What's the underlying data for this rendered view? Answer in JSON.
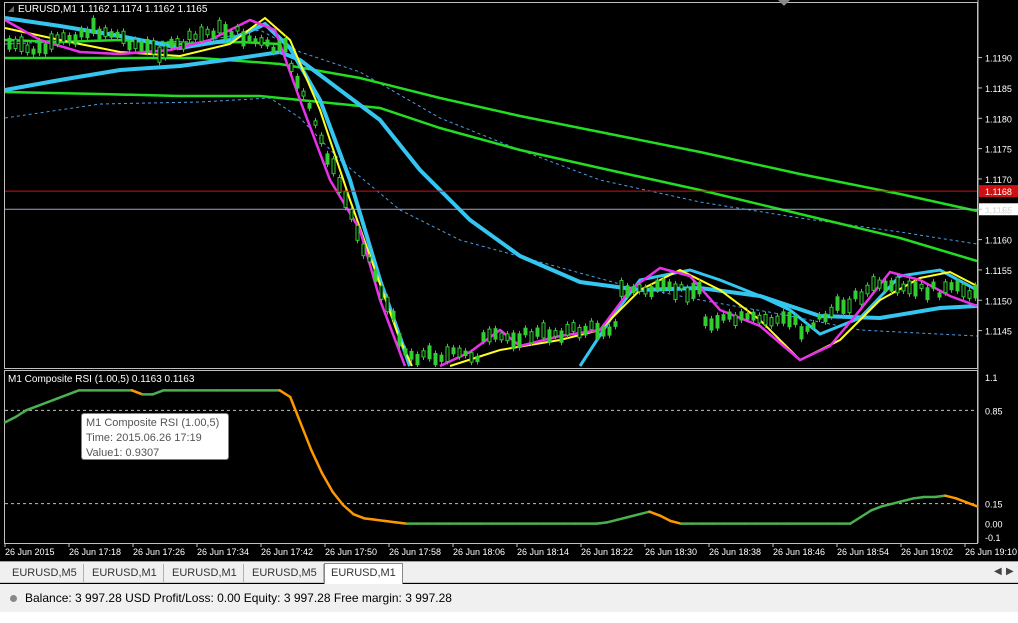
{
  "main_chart": {
    "header": "EURUSD,M1  1.1162 1.1174 1.1162 1.1165",
    "price_ticks": [
      "1.1190",
      "1.1185",
      "1.1180",
      "1.1175",
      "1.1170",
      "1.1165",
      "1.1160",
      "1.1155",
      "1.1150",
      "1.1145"
    ],
    "price_range": [
      1.1139,
      1.1199
    ],
    "bid_label": "1.1168",
    "ask_label": "1.1165",
    "bid_price": 1.1168,
    "ask_price": 1.1165,
    "colors": {
      "bid": "#d01010",
      "ask": "#9aa4c8",
      "candle_up": "#33cc33",
      "green_ma": "#22dd22",
      "cyan_ma": "#34c6f0",
      "yellow": "#ffff22",
      "magenta": "#e832e8",
      "bands": "#4a9ee6"
    }
  },
  "chart_data": {
    "type": "line",
    "title": "M1 Composite RSI (1.00,5) 0.1163 0.1163",
    "y_ticks": [
      "1.1",
      "0.85",
      "0.15",
      "0.00",
      "-0.1"
    ],
    "ylim": [
      -0.1,
      1.1
    ],
    "levels": [
      0.85,
      0.15
    ],
    "x_ticks": [
      "26 Jun 2015",
      "26 Jun 17:18",
      "26 Jun 17:26",
      "26 Jun 17:34",
      "26 Jun 17:42",
      "26 Jun 17:50",
      "26 Jun 17:58",
      "26 Jun 18:06",
      "26 Jun 18:14",
      "26 Jun 18:22",
      "26 Jun 18:30",
      "26 Jun 18:38",
      "26 Jun 18:46",
      "26 Jun 18:54",
      "26 Jun 19:02",
      "26 Jun 19:10"
    ],
    "series": [
      {
        "name": "Value1",
        "values": [
          0.76,
          0.8,
          0.85,
          0.88,
          0.91,
          0.94,
          0.97,
          1.0,
          1.0,
          1.0,
          1.0,
          1.0,
          1.0,
          0.97,
          0.97,
          1.0,
          1.0,
          1.0,
          1.0,
          1.0,
          1.0,
          1.0,
          1.0,
          1.0,
          1.0,
          1.0,
          1.0,
          0.95,
          0.75,
          0.55,
          0.38,
          0.24,
          0.14,
          0.07,
          0.04,
          0.03,
          0.02,
          0.01,
          0.0,
          0.0,
          0.0,
          0.0,
          0.0,
          0.0,
          0.0,
          0.0,
          0.0,
          0.0,
          0.0,
          0.0,
          0.0,
          0.0,
          0.0,
          0.0,
          0.0,
          0.0,
          0.0,
          0.01,
          0.03,
          0.05,
          0.07,
          0.09,
          0.06,
          0.02,
          0.0,
          0.0,
          0.0,
          0.0,
          0.0,
          0.0,
          0.0,
          0.0,
          0.0,
          0.0,
          0.0,
          0.0,
          0.0,
          0.0,
          0.0,
          0.0,
          0.0,
          0.05,
          0.1,
          0.13,
          0.15,
          0.17,
          0.19,
          0.2,
          0.2,
          0.21,
          0.19,
          0.16,
          0.13
        ]
      }
    ]
  },
  "tooltip": {
    "line1": "M1 Composite RSI (1.00,5)",
    "line2": "Time: 2015.06.26 17:19",
    "line3": "Value1: 0.9307"
  },
  "tabs": [
    "EURUSD,M5",
    "EURUSD,M1",
    "EURUSD,M1",
    "EURUSD,M5",
    "EURUSD,M1"
  ],
  "active_tab": "EURUSD,M1",
  "status_text": "Balance: 3 997.28 USD  Profit/Loss: 0.00  Equity: 3 997.28  Free margin: 3 997.28"
}
